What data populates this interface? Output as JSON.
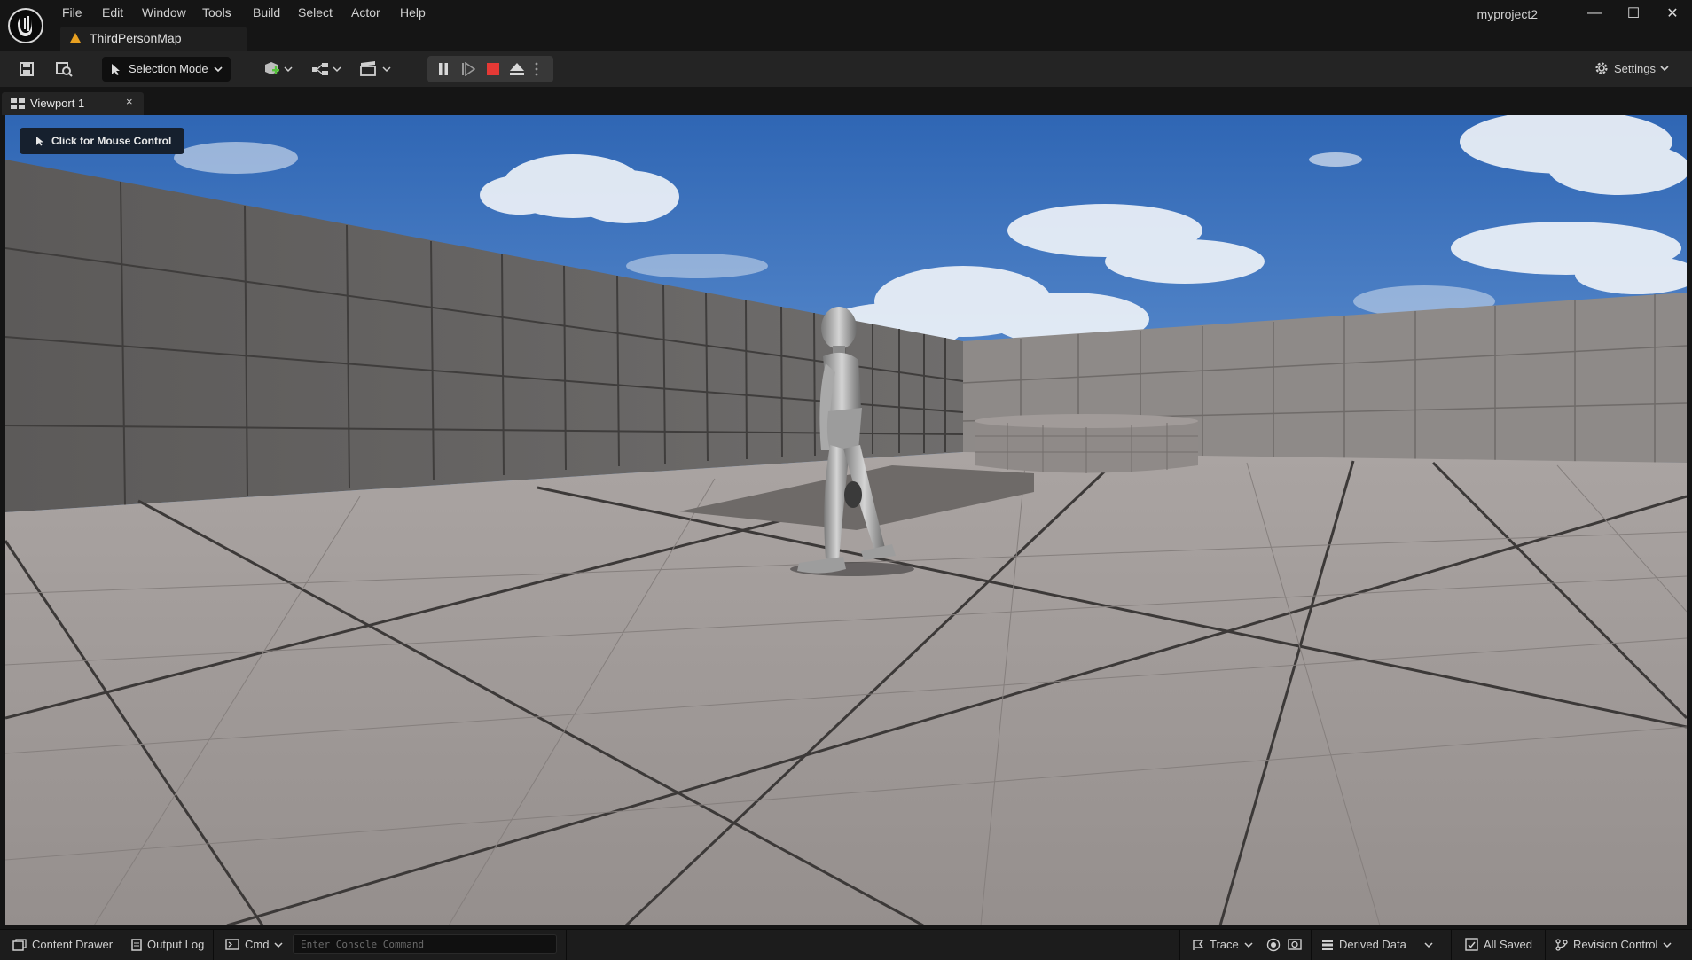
{
  "menu": [
    "File",
    "Edit",
    "Window",
    "Tools",
    "Build",
    "Select",
    "Actor",
    "Help"
  ],
  "project_name": "myproject2",
  "map_tab": {
    "label": "ThirdPersonMap",
    "icon": "level-icon"
  },
  "window_controls": {
    "minimize": "—",
    "maximize": "☐",
    "close": "✕"
  },
  "toolbar": {
    "selection_mode": "Selection Mode",
    "settings": "Settings",
    "icons": [
      "save-icon",
      "browse-icon",
      "add-actor-icon",
      "blueprint-icon",
      "cinematics-icon",
      "pause-icon",
      "skip-frame-icon",
      "stop-icon",
      "eject-icon",
      "more-options-icon"
    ]
  },
  "viewport_tab": {
    "label": "Viewport 1",
    "close": "×"
  },
  "viewport": {
    "mouse_control": "Click for Mouse Control",
    "scene": {
      "sky_color": "#4f7fc2",
      "floor_color": "#9e9896",
      "wall_color": "#6b6968"
    }
  },
  "statusbar": {
    "content_drawer": "Content Drawer",
    "output_log": "Output Log",
    "cmd": "Cmd",
    "console_placeholder": "Enter Console Command",
    "trace": "Trace",
    "derived_data": "Derived Data",
    "all_saved": "All Saved",
    "revision_control": "Revision Control"
  },
  "colors": {
    "stop": "#e53935",
    "add_green": "#55c23b",
    "level_orange": "#e8a020"
  }
}
